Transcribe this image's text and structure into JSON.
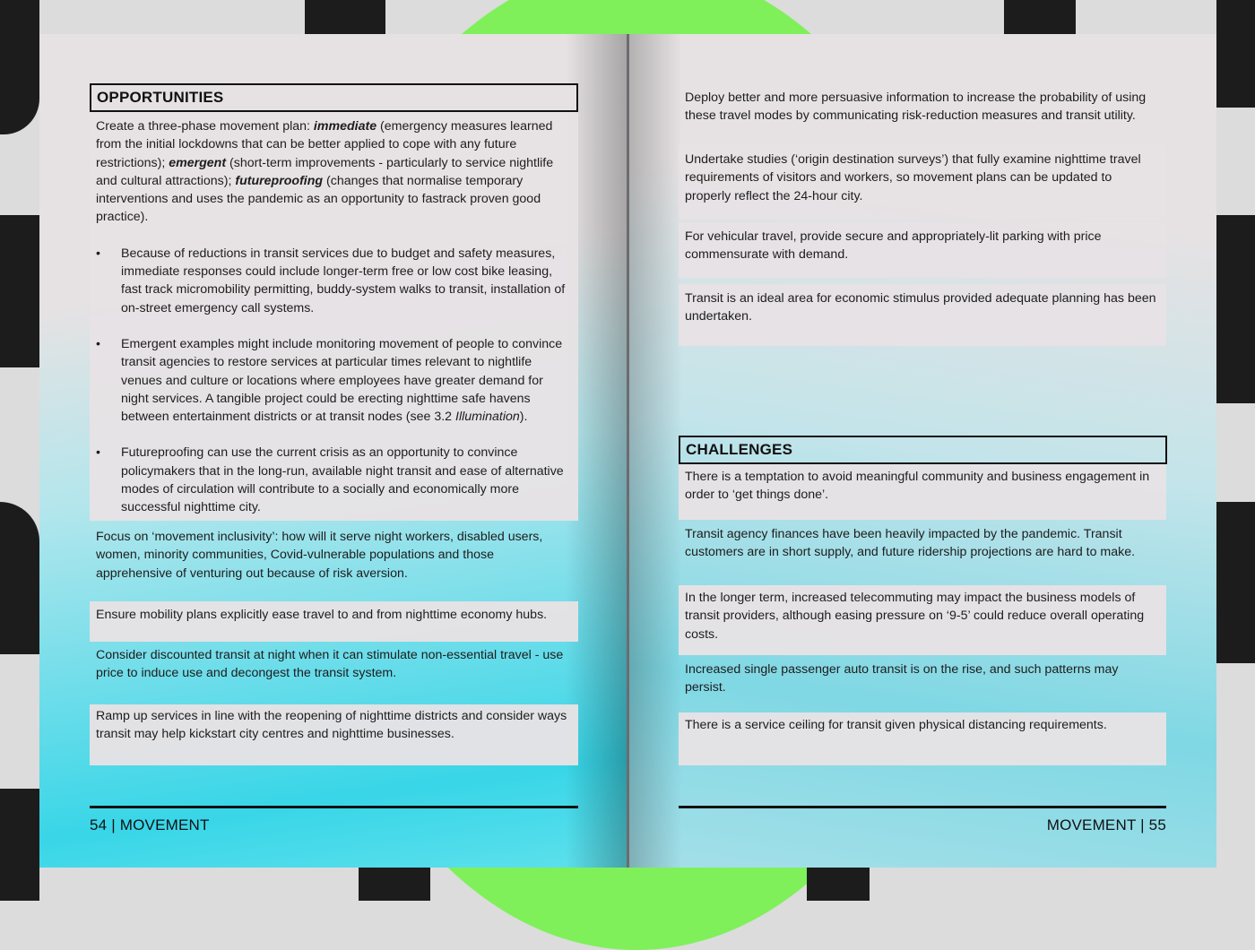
{
  "left_page": {
    "opportunities_heading": "OPPORTUNITIES",
    "intro": {
      "t1": "Create a three-phase movement plan: ",
      "b1": "immediate",
      "t2": " (emergency measures learned from the initial lockdowns that can be better applied to cope with any future restrictions); ",
      "b2": "emergent",
      "t3": " (short-term improvements - particularly to service nightlife and cultural attractions); ",
      "b3": "futureproofing",
      "t4": " (changes that normalise temporary interventions and uses the pandemic as an opportunity to fastrack proven good practice)."
    },
    "bullet_symbol": "•",
    "bullet1": "Because of reductions in transit services due to budget and safety measures, immediate responses could include longer-term free or low cost bike leasing, fast track micromobility permitting, buddy-system walks to transit, installation of on-street emergency call systems.",
    "bullet2_a": "Emergent examples might include monitoring movement of people to convince transit agencies to restore services at particular times relevant to nightlife venues and culture or locations where employees have greater demand for night services. A tangible project could be erecting nighttime safe havens between entertainment districts or at transit nodes (see 3.2 ",
    "bullet2_i": "Illumination",
    "bullet2_b": ").",
    "bullet3": "Futureproofing can use the current crisis as an opportunity to convince policymakers that in the long-run, available night transit and ease of alternative modes of circulation will contribute to a socially and economically more successful nighttime city.",
    "para_inclusivity": "Focus on ‘movement inclusivity’: how will it serve night workers, disabled users, women, minority communities, Covid-vulnerable populations and those apprehensive of venturing out because of risk aversion.",
    "para_mobility": "Ensure mobility plans explicitly ease travel to and from nighttime economy hubs.",
    "para_discounted": "Consider discounted transit at night when it can stimulate non-essential travel - use price to induce use and decongest the transit system.",
    "para_rampup": "Ramp up services in line with the reopening of nighttime districts and consider ways transit may help kickstart city centres and nighttime businesses.",
    "footer": "54  | MOVEMENT"
  },
  "right_page": {
    "para_deploy": "Deploy better and more persuasive information to increase the probability of using these travel modes by communicating risk-reduction measures and transit utility.",
    "para_studies": "Undertake studies (‘origin destination surveys’) that fully examine nighttime travel requirements of visitors and workers, so movement plans can be updated to properly reflect the 24-hour city.",
    "para_vehicular": "For vehicular travel, provide secure and appropriately-lit parking with price commensurate with demand.",
    "para_stimulus": "Transit is an ideal area for economic stimulus provided adequate planning has been undertaken.",
    "challenges_heading": "CHALLENGES",
    "chal1": "There is a temptation to avoid meaningful community and business engagement in order to ‘get things done’.",
    "chal2": "Transit agency finances have been heavily impacted by the pandemic. Transit customers are in short supply, and future ridership projections are hard to make.",
    "chal3": "In the longer term, increased telecommuting may impact the business models of transit providers, although easing pressure on ‘9-5’ could reduce overall operating costs.",
    "chal4": "Increased single passenger auto transit is on the rise, and such patterns may persist.",
    "chal5": "There is a service ceiling for transit given physical distancing requirements.",
    "footer": "MOVEMENT |  55"
  },
  "colors": {
    "accent_green": "#7ff05a",
    "accent_cyan": "#38d6e8",
    "text": "#1d1d1d"
  }
}
